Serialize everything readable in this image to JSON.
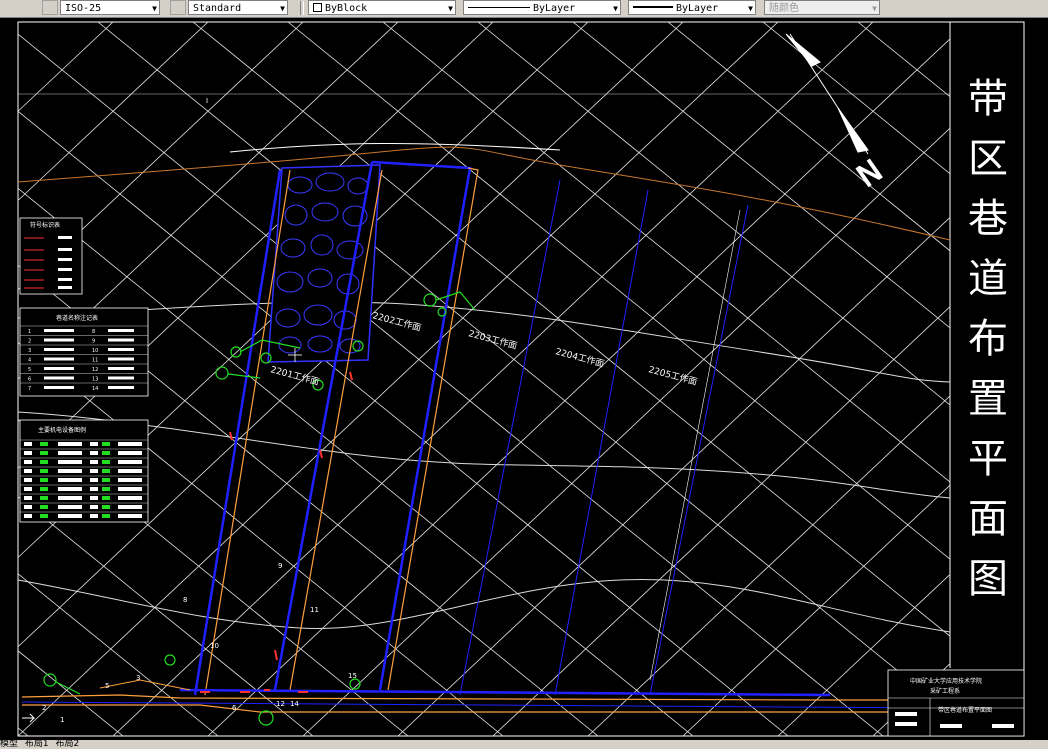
{
  "toolbar": {
    "dimstyle": "ISO-25",
    "textstyle": "Standard",
    "color": "ByBlock",
    "linetype": "ByLayer",
    "lineweight": "ByLayer",
    "plotstyle": "随颜色"
  },
  "drawing": {
    "title_chars": [
      "带",
      "区",
      "巷",
      "道",
      "布",
      "置",
      "平",
      "面",
      "图"
    ],
    "north_label": "N",
    "workfaces": [
      "2202工作面",
      "2203工作面",
      "2201工作面",
      "2204工作面",
      "2205工作面"
    ],
    "point_labels": [
      "1",
      "2",
      "3",
      "4",
      "5",
      "6",
      "7",
      "8",
      "9",
      "10",
      "11",
      "12",
      "13",
      "14",
      "15",
      "I"
    ],
    "legend1_title": "符号标识表",
    "legend2_title": "巷道名称注记表",
    "legend3_title": "主要机电设备图例",
    "legend2_rows": [
      [
        "1",
        "8"
      ],
      [
        "2",
        "9"
      ],
      [
        "3",
        "10"
      ],
      [
        "4",
        "11"
      ],
      [
        "5",
        "12"
      ],
      [
        "6",
        "13"
      ],
      [
        "7",
        "14"
      ]
    ],
    "titleblock_line1": "中国矿业大学应用技术学院",
    "titleblock_line2": "采矿工程系",
    "titleblock_drawing": "带区巷道布置平面图"
  },
  "layout_tabs": [
    "模型",
    "布局1",
    "布局2"
  ],
  "colors": {
    "grid": "#ffffff",
    "roadway": "#1a1aff",
    "boundary": "#ffa040",
    "legend": "#00ff00"
  }
}
